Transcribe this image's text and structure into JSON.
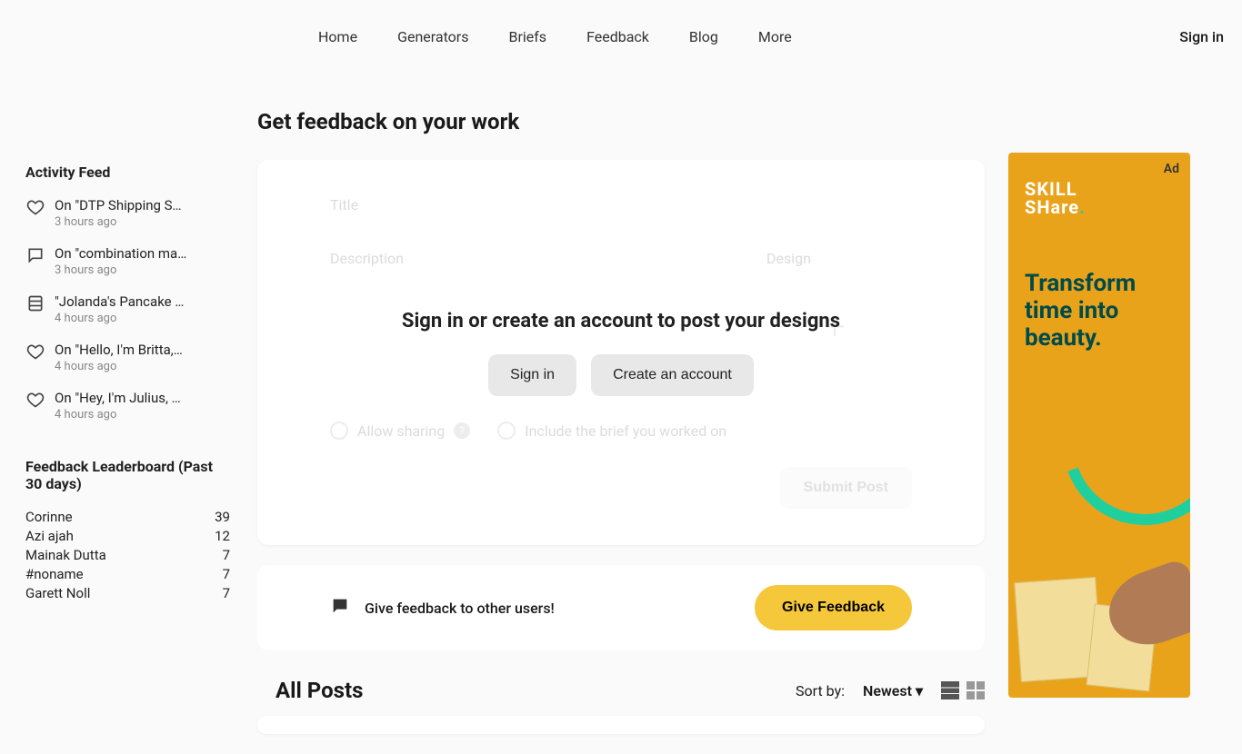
{
  "nav": {
    "items": [
      "Home",
      "Generators",
      "Briefs",
      "Feedback",
      "Blog",
      "More"
    ],
    "signin": "Sign in"
  },
  "page_title": "Get feedback on your work",
  "form": {
    "title_label": "Title",
    "description_label": "Description",
    "design_label": "Design",
    "allow_sharing": "Allow sharing",
    "include_brief": "Include the brief you worked on",
    "submit": "Submit Post"
  },
  "overlay": {
    "heading": "Sign in or create an account to post your designs",
    "signin": "Sign in",
    "create": "Create an account"
  },
  "feedback_bar": {
    "text": "Give feedback to other users!",
    "button": "Give Feedback"
  },
  "posts": {
    "heading": "All Posts",
    "sort_label": "Sort by:",
    "sort_value": "Newest"
  },
  "sidebar": {
    "feed_title": "Activity Feed",
    "items": [
      {
        "icon": "heart",
        "title": "On \"DTP Shipping S…",
        "time": "3 hours ago"
      },
      {
        "icon": "comment",
        "title": "On \"combination ma…",
        "time": "3 hours ago"
      },
      {
        "icon": "brief",
        "title": "\"Jolanda's Pancake …",
        "time": "4 hours ago"
      },
      {
        "icon": "heart",
        "title": "On \"Hello, I'm Britta,…",
        "time": "4 hours ago"
      },
      {
        "icon": "heart",
        "title": "On \"Hey, I'm Julius, …",
        "time": "4 hours ago"
      }
    ],
    "leaderboard_title": "Feedback Leaderboard (Past 30 days)",
    "leaderboard": [
      {
        "name": "Corinne",
        "count": "39"
      },
      {
        "name": "Azi ajah",
        "count": "12"
      },
      {
        "name": "Mainak Dutta",
        "count": "7"
      },
      {
        "name": "#noname",
        "count": "7"
      },
      {
        "name": "Garett Noll",
        "count": "7"
      }
    ]
  },
  "ad": {
    "tag": "Ad",
    "brand_a": "SKILL",
    "brand_b": "SHare",
    "tagline": "Transform time into beauty."
  }
}
